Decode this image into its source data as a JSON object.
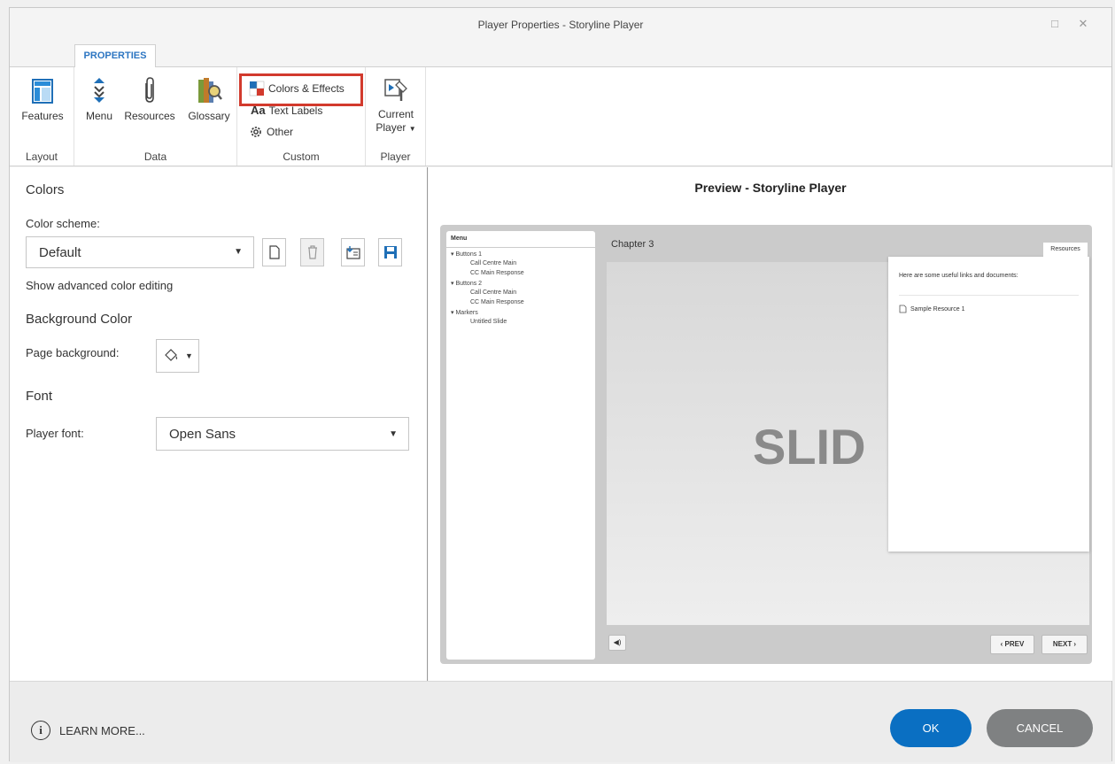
{
  "window": {
    "title": "Player Properties - Storyline Player"
  },
  "ribbon": {
    "tab_label": "PROPERTIES",
    "features_label": "Features",
    "menu_label": "Menu",
    "resources_label": "Resources",
    "glossary_label": "Glossary",
    "colors_effects_label": "Colors & Effects",
    "text_labels_label": "Text Labels",
    "other_label": "Other",
    "current_player_label_1": "Current",
    "current_player_label_2": "Player",
    "group_layout": "Layout",
    "group_data": "Data",
    "group_custom": "Custom",
    "group_player": "Player",
    "text_labels_prefix": "Aa"
  },
  "colors": {
    "section_title": "Colors",
    "scheme_label": "Color scheme:",
    "scheme_value": "Default",
    "advanced_link": "Show advanced color editing"
  },
  "background": {
    "section_title": "Background Color",
    "page_bg_label": "Page background:"
  },
  "font": {
    "section_title": "Font",
    "player_font_label": "Player font:",
    "player_font_value": "Open Sans"
  },
  "preview": {
    "title": "Preview - Storyline Player",
    "menu_tab": "Menu",
    "menu_items": [
      {
        "text": "Buttons 1",
        "level": 0
      },
      {
        "text": "Call Centre Main",
        "level": 1
      },
      {
        "text": "CC Main Response",
        "level": 1
      },
      {
        "text": "Buttons 2",
        "level": 0
      },
      {
        "text": "Call Centre Main",
        "level": 1
      },
      {
        "text": "CC Main Response",
        "level": 1
      },
      {
        "text": "Markers",
        "level": 0
      },
      {
        "text": "Untitled Slide",
        "level": 1
      }
    ],
    "chapter_title": "Chapter 3",
    "slide_text": "SLID",
    "resources_tab": "Resources",
    "resources_intro": "Here are some useful links and documents:",
    "resource_item": "Sample Resource 1",
    "prev_label": "‹ PREV",
    "next_label": "NEXT ›"
  },
  "footer": {
    "learn_more": "LEARN MORE...",
    "ok_label": "OK",
    "cancel_label": "CANCEL"
  },
  "colors_theme": {
    "accent_blue": "#0a6fc2",
    "cancel_gray": "#7f8182",
    "highlight_red": "#d23a2d",
    "tab_blue": "#2d76c2"
  },
  "icons": [
    "features-icon",
    "menu-icon",
    "resources-icon",
    "glossary-icon",
    "colors-effects-icon",
    "text-labels-icon",
    "gear-icon",
    "current-player-icon",
    "new-icon",
    "delete-icon",
    "import-icon",
    "save-icon",
    "paint-bucket-icon",
    "info-icon",
    "volume-icon",
    "document-icon"
  ]
}
